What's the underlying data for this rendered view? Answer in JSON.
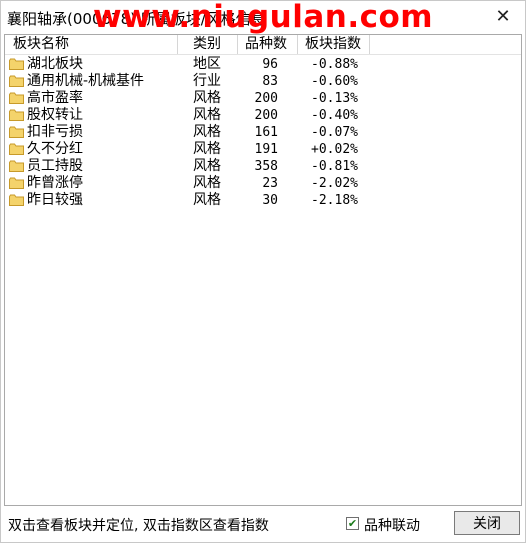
{
  "window": {
    "title": "襄阳轴承(000678) 所属板块/风格信息",
    "watermark": "www.niugulan.com",
    "close_glyph": "✕"
  },
  "table": {
    "columns": [
      "板块名称",
      "类别",
      "品种数",
      "板块指数"
    ],
    "rows": [
      {
        "name": "湖北板块",
        "category": "地区",
        "count": "96",
        "index": "-0.88%"
      },
      {
        "name": "通用机械-机械基件",
        "category": "行业",
        "count": "83",
        "index": "-0.60%"
      },
      {
        "name": "高市盈率",
        "category": "风格",
        "count": "200",
        "index": "-0.13%"
      },
      {
        "name": "股权转让",
        "category": "风格",
        "count": "200",
        "index": "-0.40%"
      },
      {
        "name": "扣非亏损",
        "category": "风格",
        "count": "161",
        "index": "-0.07%"
      },
      {
        "name": "久不分红",
        "category": "风格",
        "count": "191",
        "index": "+0.02%"
      },
      {
        "name": "员工持股",
        "category": "风格",
        "count": "358",
        "index": "-0.81%"
      },
      {
        "name": "昨曾涨停",
        "category": "风格",
        "count": "23",
        "index": "-2.02%"
      },
      {
        "name": "昨日较强",
        "category": "风格",
        "count": "30",
        "index": "-2.18%"
      }
    ],
    "row_icon": "folder-icon"
  },
  "footer": {
    "hint": "双击查看板块并定位, 双击指数区查看指数",
    "checkbox_label": "品种联动",
    "checkbox_checked": true,
    "close_label": "关闭"
  },
  "colors": {
    "watermark": "#ff0000",
    "folder_fill": "#f4d36b",
    "folder_edge": "#c79a2a"
  }
}
